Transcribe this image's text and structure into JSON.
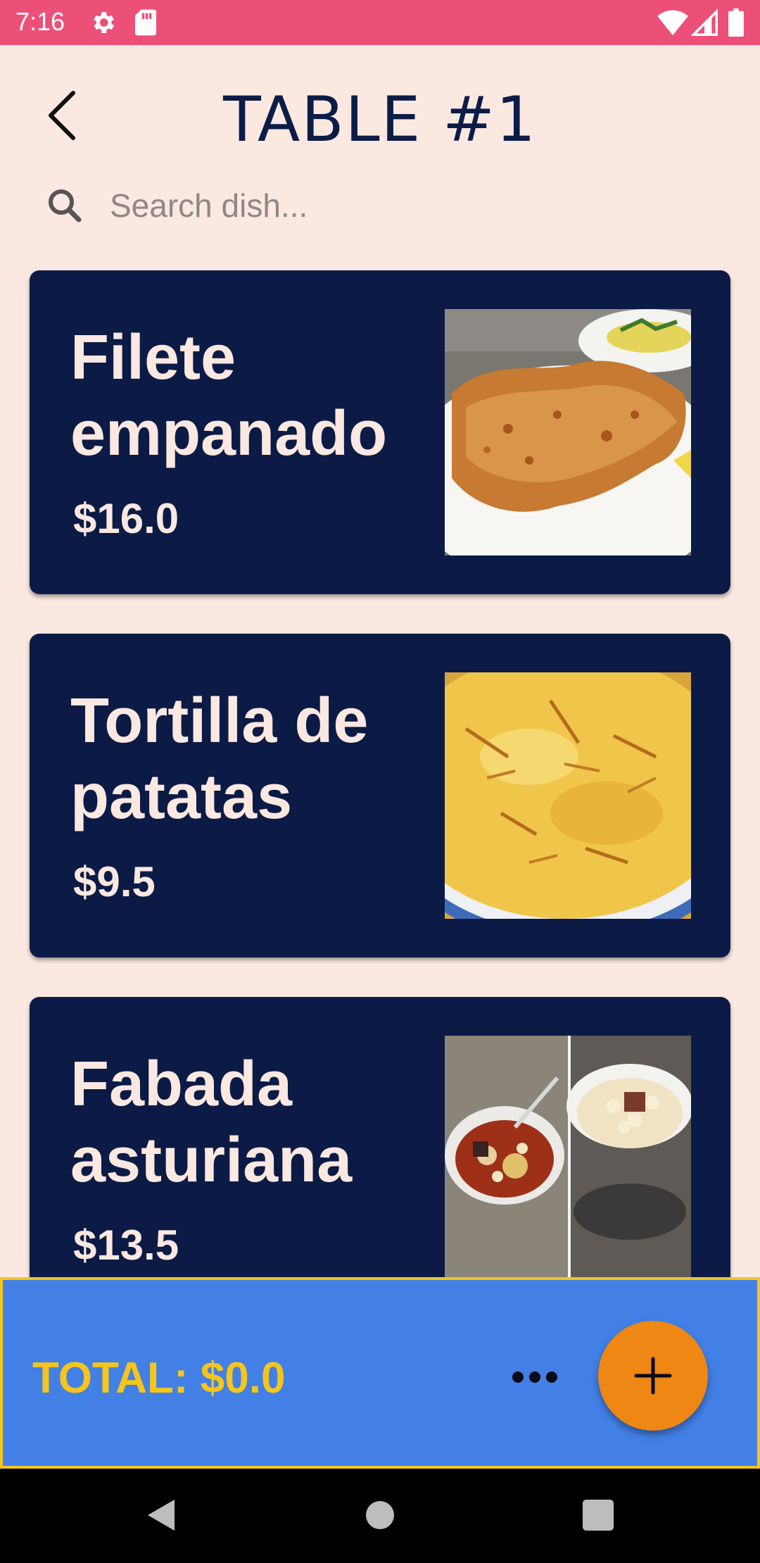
{
  "status_bar": {
    "time": "7:16",
    "icons": [
      "gear-icon",
      "sd-card-icon",
      "wifi-icon",
      "signal-icon",
      "battery-icon"
    ],
    "color": "#ec5079"
  },
  "header": {
    "title": "TABLE #1",
    "back_icon": "back-arrow-icon"
  },
  "search": {
    "placeholder": "Search dish...",
    "icon": "search-icon"
  },
  "dishes": [
    {
      "name": "Filete empanado",
      "price": "$16.0",
      "image": "breaded-steak-photo"
    },
    {
      "name": "Tortilla de patatas",
      "price": "$9.5",
      "image": "potato-omelette-photo"
    },
    {
      "name": "Fabada asturiana",
      "price": "$13.5",
      "image": "bean-stew-photo"
    }
  ],
  "bottom_bar": {
    "total": "TOTAL: $0.0",
    "more_icon": "more-horizontal-icon",
    "add_icon": "plus-icon"
  },
  "nav_bar": {
    "icons": [
      "nav-back-icon",
      "nav-home-icon",
      "nav-recents-icon"
    ]
  },
  "colors": {
    "background": "#fae8e1",
    "card": "#0b1b45",
    "bottom_bar": "#4280e5",
    "accent_yellow": "#f5c51c",
    "fab": "#ee8714"
  }
}
